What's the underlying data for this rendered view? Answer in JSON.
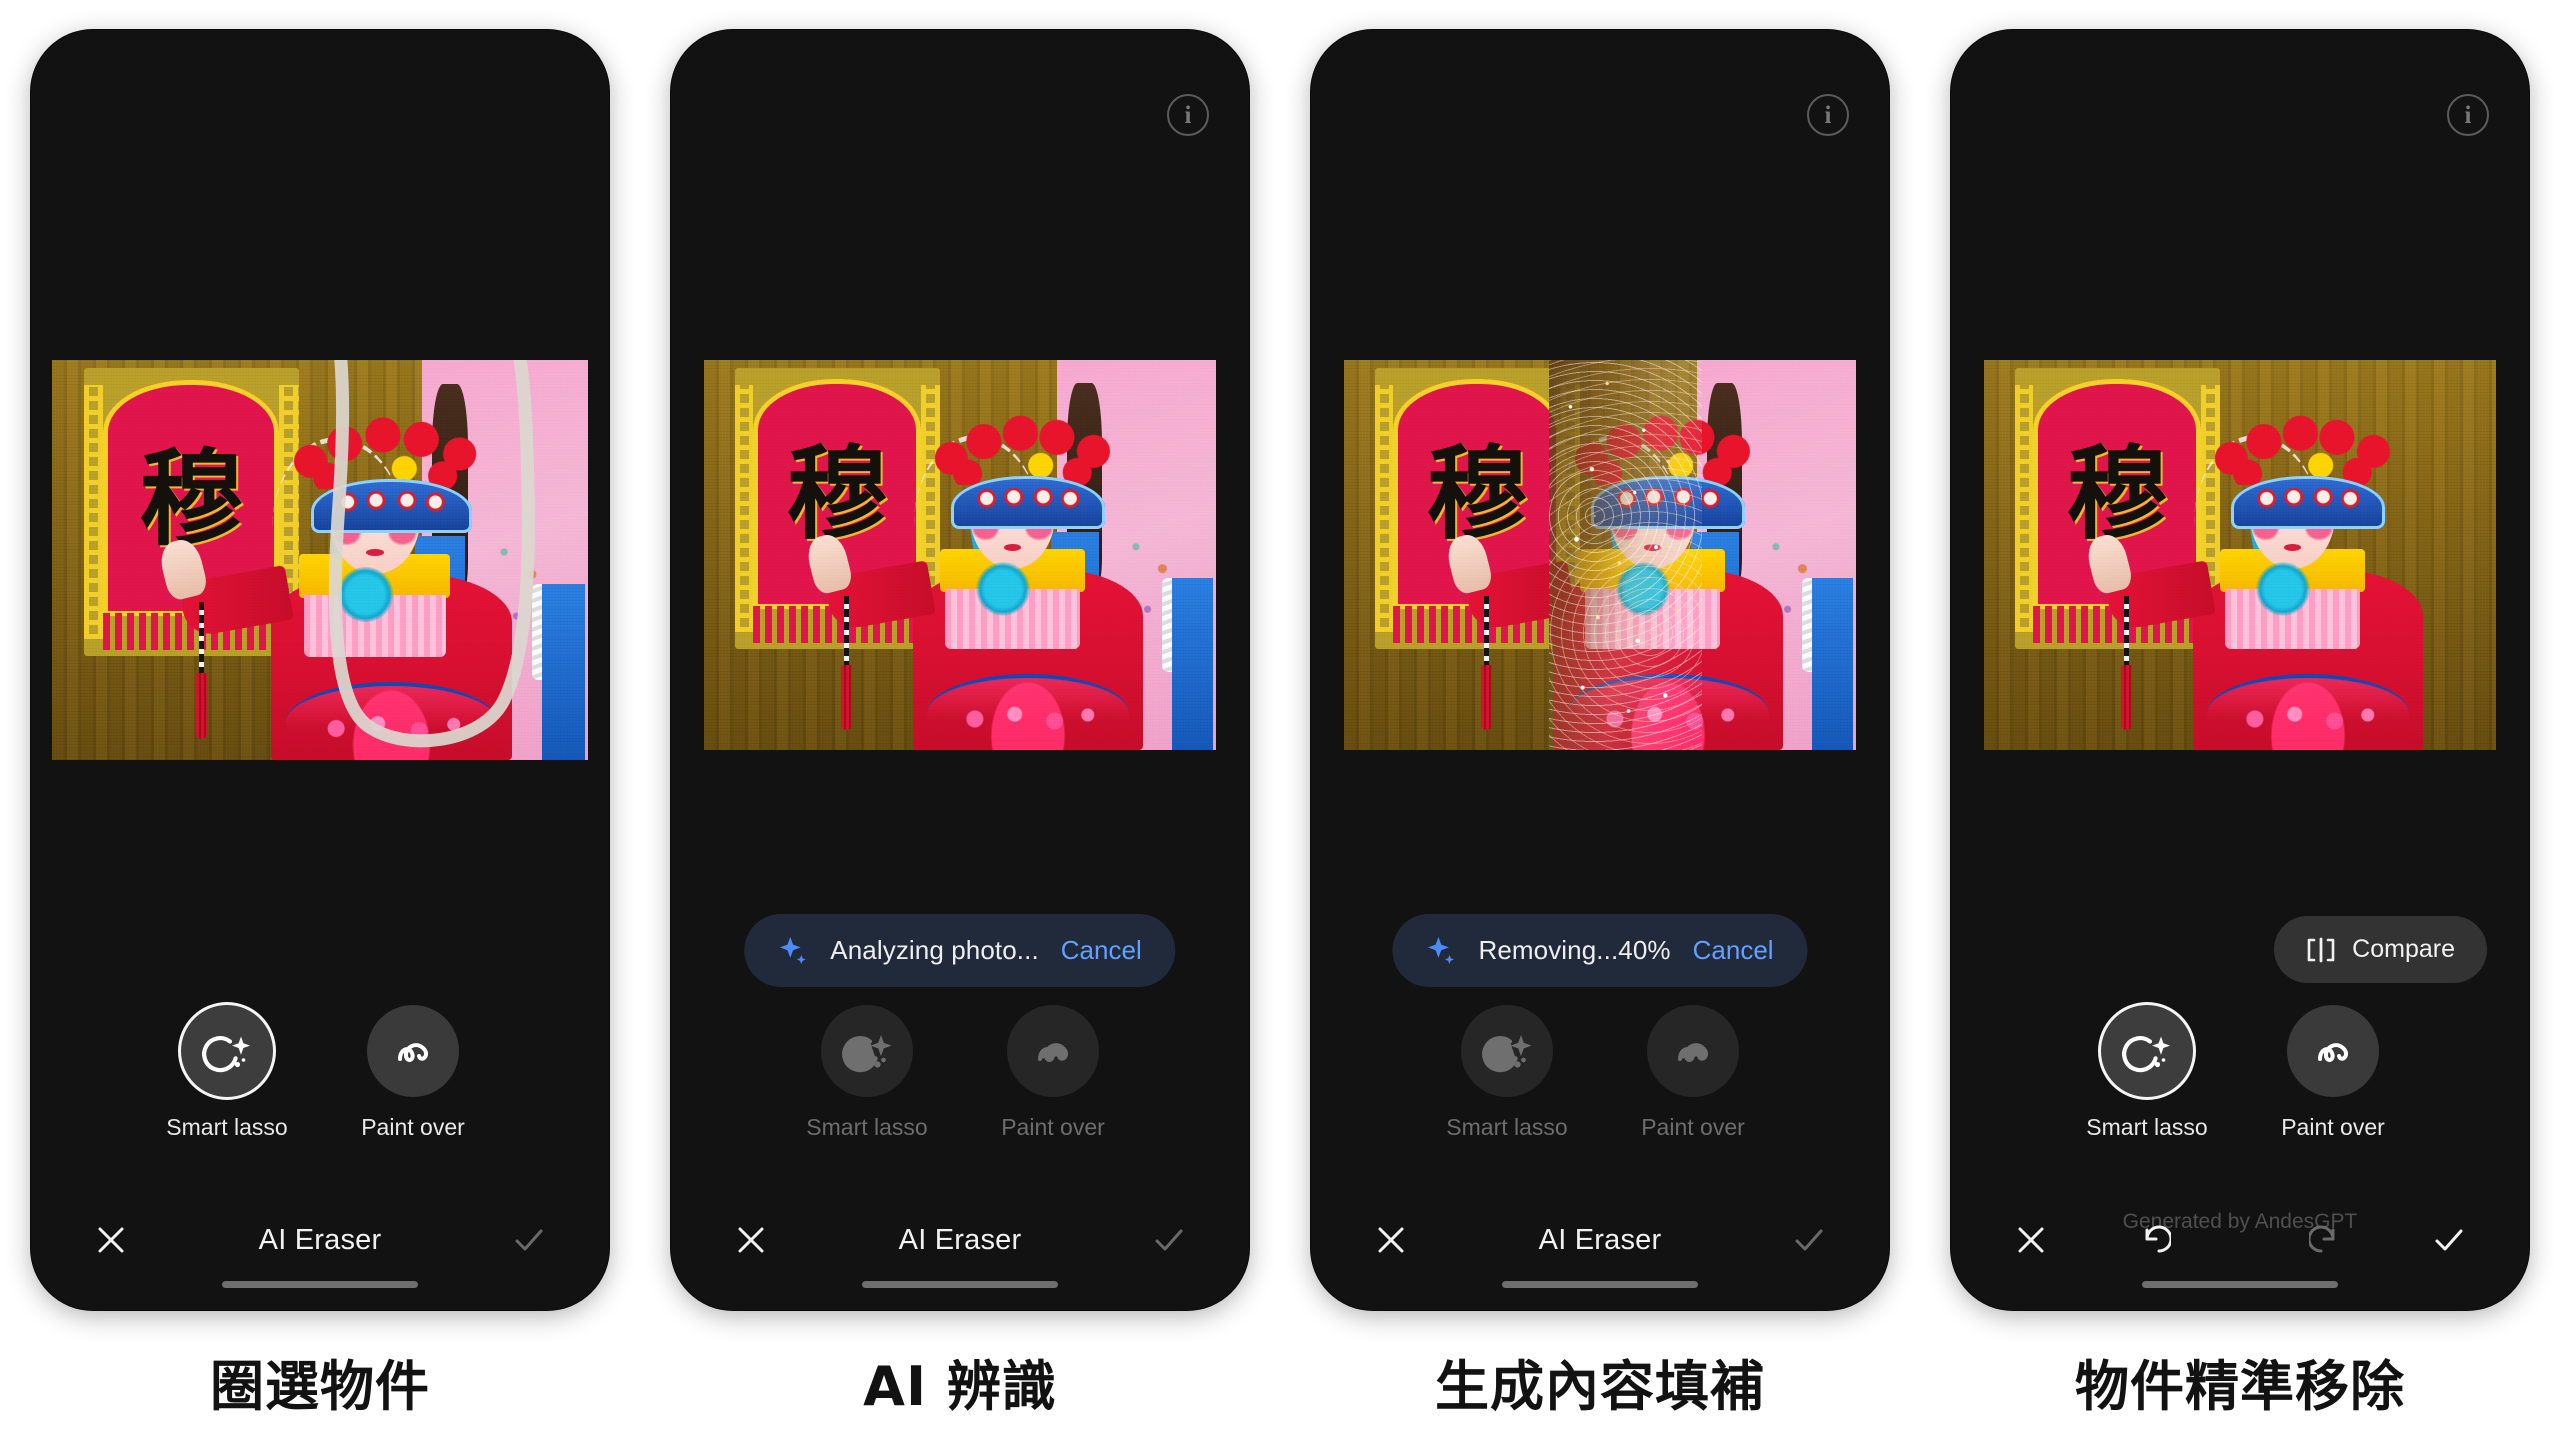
{
  "app": {
    "title": "AI Eraser"
  },
  "photo": {
    "banner_glyph": "穆",
    "alt": "child Peking opera performer in red costume before a red banner"
  },
  "panels": [
    {
      "id": "select-object",
      "caption": "圈選物件",
      "info_icon": false,
      "pill": null,
      "compare": null,
      "watermark": null,
      "tools_state": "active",
      "bottom": {
        "type": "title",
        "title": "AI Eraser",
        "check_dim": true
      },
      "lasso": true,
      "dissolve": false,
      "subject_removed": false
    },
    {
      "id": "ai-recognition",
      "caption": "AI 辨識",
      "info_icon": true,
      "pill": {
        "label": "Analyzing photo...",
        "cancel": "Cancel"
      },
      "compare": null,
      "watermark": null,
      "tools_state": "dim",
      "bottom": {
        "type": "title",
        "title": "AI Eraser",
        "check_dim": true
      },
      "lasso": false,
      "dissolve": false,
      "subject_removed": false
    },
    {
      "id": "generative-fill",
      "caption": "生成內容填補",
      "info_icon": true,
      "pill": {
        "label": "Removing...40%",
        "cancel": "Cancel"
      },
      "compare": null,
      "watermark": null,
      "tools_state": "dim",
      "bottom": {
        "type": "title",
        "title": "AI Eraser",
        "check_dim": true
      },
      "lasso": false,
      "dissolve": true,
      "subject_removed": false
    },
    {
      "id": "precise-removal",
      "caption": "物件精準移除",
      "info_icon": true,
      "pill": null,
      "compare": {
        "label": "Compare"
      },
      "watermark": "Generated by AndesGPT",
      "tools_state": "active",
      "bottom": {
        "type": "undo-redo",
        "check_dim": false
      },
      "lasso": false,
      "dissolve": false,
      "subject_removed": true
    }
  ],
  "tools": [
    {
      "id": "smart-lasso",
      "label": "Smart lasso",
      "icon": "smart-lasso-icon"
    },
    {
      "id": "paint-over",
      "label": "Paint over",
      "icon": "paint-over-icon"
    }
  ],
  "icons": {
    "info": "info-icon",
    "close": "close-icon",
    "check": "check-icon",
    "undo": "undo-icon",
    "redo": "redo-icon",
    "sparkle": "sparkle-icon",
    "compare": "compare-icon"
  },
  "colors": {
    "phone_bg": "#121212",
    "pill_bg": "#212a3b",
    "accent_blue": "#63a0ff",
    "sparkle_blue": "#4d8bfb",
    "tool_circle": "#3a3a3a",
    "compare_bg": "#333333",
    "page_bg": "#ffffff",
    "caption": "#121212"
  }
}
